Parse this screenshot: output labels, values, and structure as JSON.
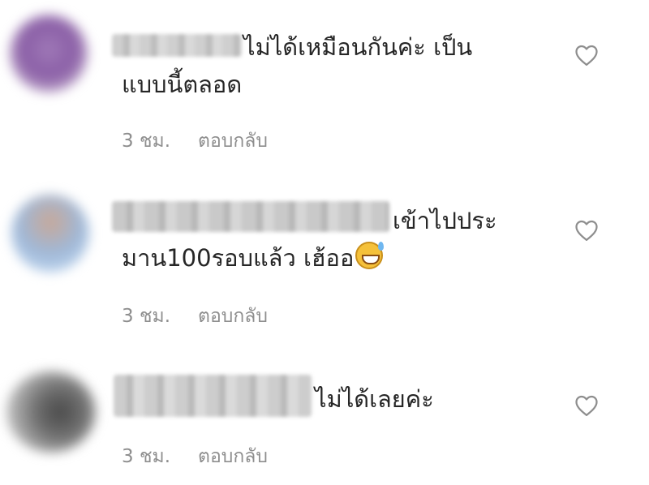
{
  "comments": [
    {
      "text_line1": "ไม่ได้เหมือนกันค่ะ เป็น",
      "text_line2": "แบบนี้ตลอด",
      "time": "3 ชม.",
      "reply_label": "ตอบกลับ",
      "like_icon": "heart-outline-icon"
    },
    {
      "text_line1": "เข้าไปประ",
      "text_line2": "มาน100รอบแล้ว เฮ้ออ",
      "emoji": "grinning-sweat-emoji",
      "time": "3 ชม.",
      "reply_label": "ตอบกลับ",
      "like_icon": "heart-outline-icon"
    },
    {
      "text_line1": "ไม่ได้เลยค่ะ",
      "time": "3 ชม.",
      "reply_label": "ตอบกลับ",
      "like_icon": "heart-outline-icon"
    }
  ],
  "colors": {
    "text": "#262626",
    "meta": "#8e8e8e",
    "icon": "#8e8e8e",
    "background": "#ffffff"
  }
}
